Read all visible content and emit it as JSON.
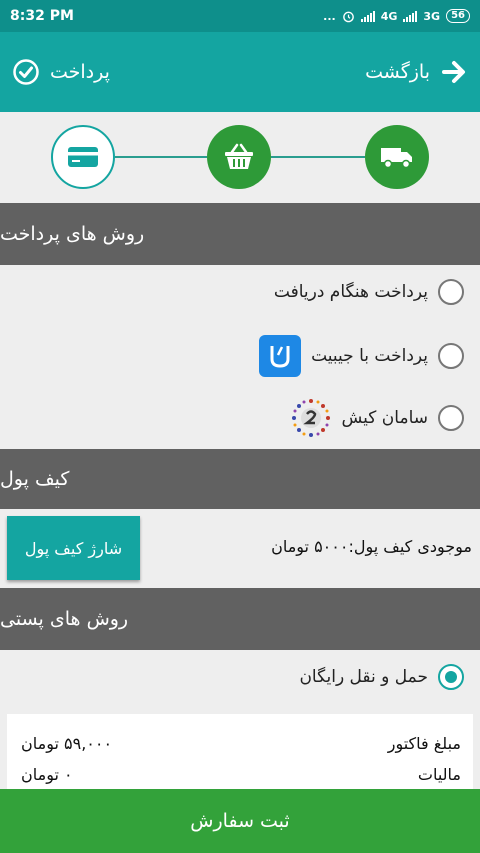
{
  "status_bar": {
    "time": "8:32 PM",
    "indicators": "...",
    "network_1": "4G",
    "network_2": "3G",
    "battery": "56"
  },
  "app_bar": {
    "back_label": "بازگشت",
    "title": "پرداخت",
    "back_icon": "arrow-right-icon",
    "title_icon": "check-circle-icon"
  },
  "steps": [
    {
      "icon": "credit-card-icon",
      "state": "current"
    },
    {
      "icon": "basket-icon",
      "state": "done"
    },
    {
      "icon": "truck-icon",
      "state": "done"
    }
  ],
  "payment_methods": {
    "header": "روش های پرداخت",
    "options": [
      {
        "label": "پرداخت هنگام دریافت",
        "checked": false
      },
      {
        "label": "پرداخت با جیبیت",
        "checked": false,
        "logo": "jibit-logo"
      },
      {
        "label": "سامان کیش",
        "checked": false,
        "logo": "saman-logo"
      }
    ]
  },
  "wallet": {
    "header": "کیف پول",
    "balance_text": "موجودی کیف پول:۵۰۰۰ تومان",
    "charge_label": "شارژ کیف پول"
  },
  "shipping": {
    "header": "روش های پستی",
    "options": [
      {
        "label": "حمل و نقل رایگان",
        "checked": true
      }
    ]
  },
  "invoice": {
    "rows": [
      {
        "label": "مبلغ فاکتور",
        "value": "۵۹,۰۰۰ تومان"
      },
      {
        "label": "مالیات",
        "value": "۰ تومان"
      }
    ]
  },
  "submit_label": "ثبت سفارش",
  "colors": {
    "primary": "#14a5a1",
    "status_bar": "#0e8f8b",
    "success": "#33a23a",
    "section_header": "#616161",
    "jibit": "#1e88e5"
  }
}
